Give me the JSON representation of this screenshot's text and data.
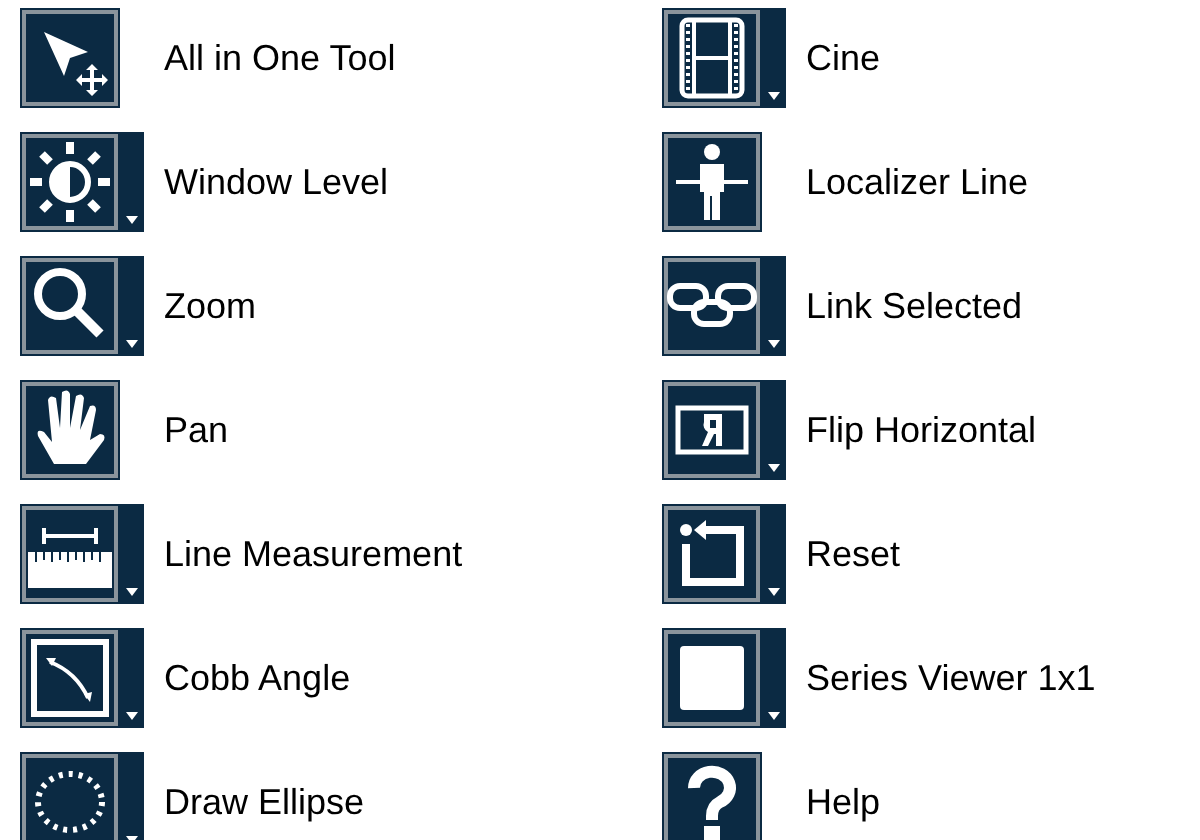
{
  "columns": [
    {
      "tools": [
        {
          "kind": "pointer",
          "label": "All in One Tool",
          "dropdown": false
        },
        {
          "kind": "sun",
          "label": "Window Level",
          "dropdown": true
        },
        {
          "kind": "magnifier",
          "label": "Zoom",
          "dropdown": true
        },
        {
          "kind": "hand",
          "label": "Pan",
          "dropdown": false
        },
        {
          "kind": "ruler",
          "label": "Line Measurement",
          "dropdown": true
        },
        {
          "kind": "angle",
          "label": "Cobb Angle",
          "dropdown": true
        },
        {
          "kind": "ellipse",
          "label": "Draw Ellipse",
          "dropdown": true
        }
      ]
    },
    {
      "tools": [
        {
          "kind": "film",
          "label": "Cine",
          "dropdown": true
        },
        {
          "kind": "person",
          "label": "Localizer Line",
          "dropdown": false
        },
        {
          "kind": "chain",
          "label": "Link Selected",
          "dropdown": true
        },
        {
          "kind": "flip",
          "label": "Flip Horizontal",
          "dropdown": true
        },
        {
          "kind": "reset",
          "label": "Reset",
          "dropdown": true
        },
        {
          "kind": "square",
          "label": "Series Viewer 1x1",
          "dropdown": true
        },
        {
          "kind": "help",
          "label": "Help",
          "dropdown": false
        }
      ]
    }
  ]
}
